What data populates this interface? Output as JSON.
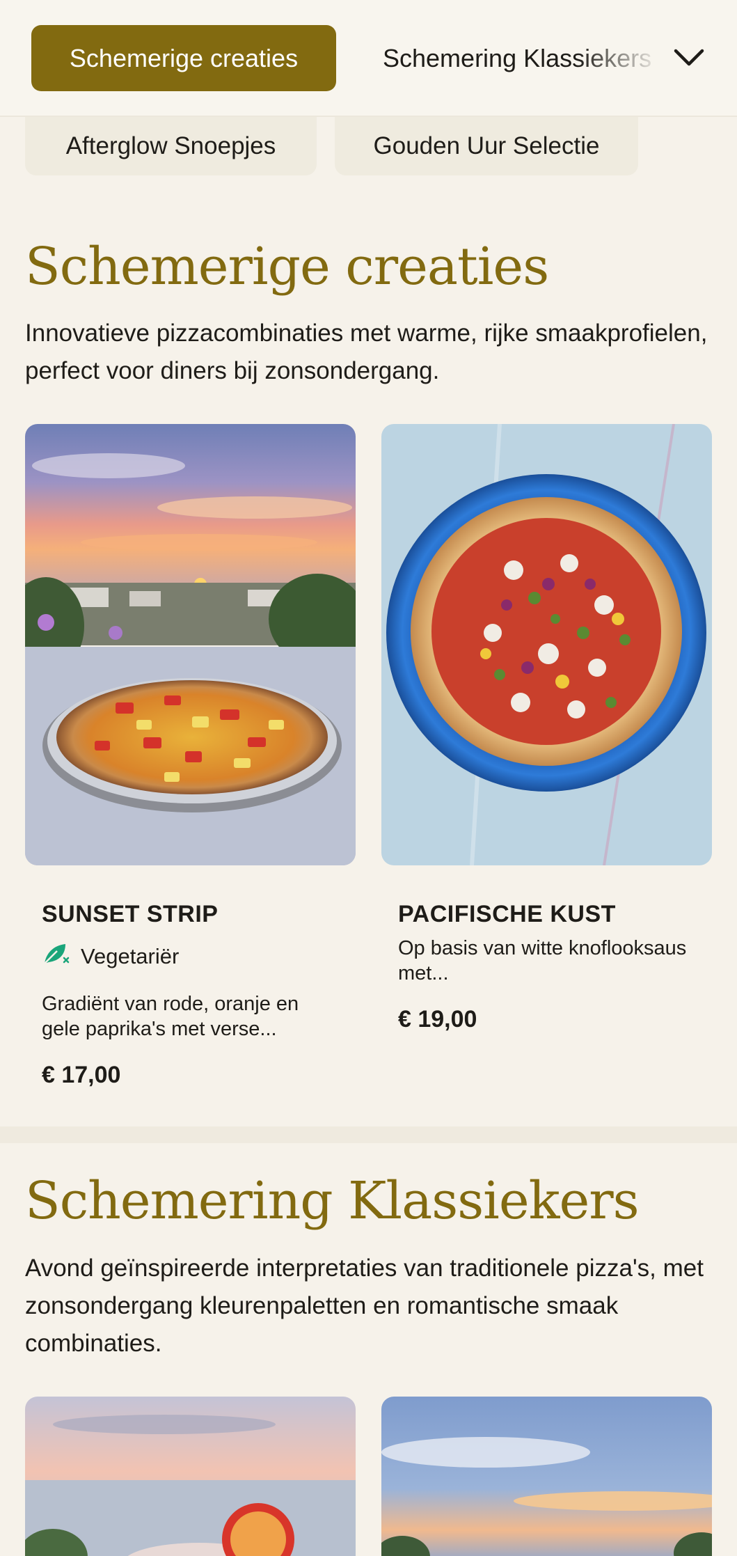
{
  "nav": {
    "active_category": "Schemerige creaties",
    "next_category": "Schemering Klassiekers",
    "expand_icon": "chevron-down-icon",
    "row2": [
      "Afterglow Snoepjes",
      "Gouden Uur Selectie"
    ]
  },
  "sections": [
    {
      "title": "Schemerige creaties",
      "description": "Innovatieve pizzacombinaties met warme, rijke smaakprofielen, perfect voor diners bij zonsondergang.",
      "items": [
        {
          "name": "SUNSET STRIP",
          "tag": "Vegetariër",
          "tag_icon": "vegetarian-leaf-icon",
          "description": "Gradiënt van rode, oranje en gele paprika's met verse...",
          "price": "€ 17,00"
        },
        {
          "name": "PACIFISCHE KUST",
          "description": "Op basis van witte knoflooksaus met...",
          "price": "€ 19,00"
        }
      ]
    },
    {
      "title": "Schemering Klassiekers",
      "description": "Avond geïnspireerde interpretaties van traditionele pizza's, met zonsondergang kleurenpaletten en romantische smaak combinaties."
    }
  ],
  "colors": {
    "accent": "#826a10",
    "background": "#f6f2ea",
    "chip_bg": "#efebdf",
    "vegetarian": "#1aa57a"
  }
}
